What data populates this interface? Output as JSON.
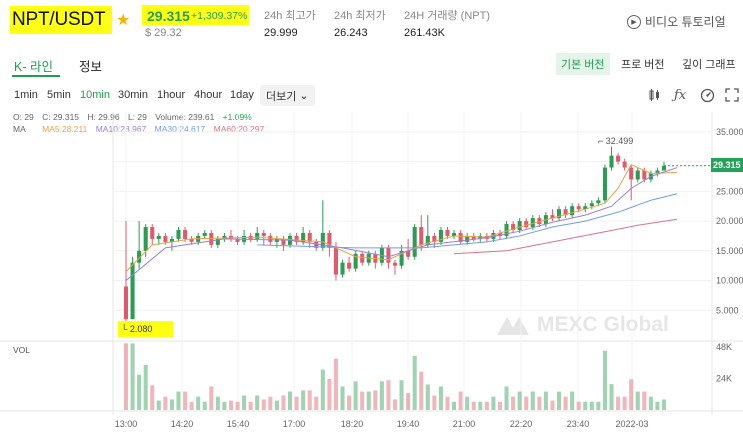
{
  "header": {
    "pair": "NPT/USDT",
    "last_price": "29.315",
    "change_pct": "+1,309.37%",
    "usd_price": "$ 29.32",
    "stats": [
      {
        "label": "24h 최고가",
        "value": "29.999"
      },
      {
        "label": "24h 최저가",
        "value": "26.243"
      },
      {
        "label": "24H 거래량 (NPT)",
        "value": "261.43K"
      }
    ],
    "tutorial_label": "비디오 튜토리얼",
    "colors": {
      "highlight": "#ffff14",
      "up": "#2a9d53",
      "down": "#e05a6b",
      "star": "#f5b400"
    }
  },
  "tabs": {
    "kline": "K- 라인",
    "info": "정보",
    "views": [
      "기본 버전",
      "프로 버전",
      "깊이 그래프"
    ]
  },
  "toolbar": {
    "timeframes": [
      "1min",
      "5min",
      "10min",
      "30min",
      "1hour",
      "4hour",
      "1day"
    ],
    "active_timeframe": "10min",
    "more_label": "더보기",
    "icons": [
      "candle-type-icon",
      "indicator-fx-icon",
      "settings-icon",
      "fullscreen-icon"
    ]
  },
  "indicators": {
    "ohlc": {
      "o": "O: 29",
      "c": "C: 29.315",
      "h": "H: 29.96",
      "l": "L: 29",
      "volume": "Volume: 239.61",
      "change": "+1.09%"
    },
    "ma_label": "MA",
    "ma5": "MA5:28.211",
    "ma10": "MA10:28.967",
    "ma30": "MA30:24.617",
    "ma60": "MA60:20.297",
    "vol_label": "VOL"
  },
  "watermark": "MEXC Global",
  "chart_data": {
    "type": "candlestick",
    "price_axis": {
      "ticks": [
        "35.000",
        "30.000",
        "25.000",
        "20.000",
        "15.000",
        "10.000",
        "5.000"
      ],
      "min": 0,
      "max": 37
    },
    "volume_axis": {
      "ticks": [
        "48K",
        "24K"
      ],
      "max": 52000
    },
    "time_ticks": [
      "13:00",
      "14:20",
      "15:40",
      "17:00",
      "18:20",
      "19:40",
      "21:00",
      "22:20",
      "23:40",
      "2022-03"
    ],
    "current_price": "29.315",
    "high_label": "32.499",
    "low_label": "2.080",
    "candles": [
      [
        9,
        3.5,
        20,
        2.08
      ],
      [
        3.5,
        13,
        14,
        3.5
      ],
      [
        13,
        15,
        20,
        12
      ],
      [
        15,
        19,
        19.5,
        14
      ],
      [
        19,
        17,
        19.5,
        16
      ],
      [
        17,
        17.5,
        18,
        16
      ],
      [
        17.5,
        16.5,
        18,
        16
      ],
      [
        16.5,
        17,
        17.5,
        15
      ],
      [
        17,
        18.5,
        19,
        16.5
      ],
      [
        18.5,
        17,
        19,
        16.5
      ],
      [
        17,
        16.5,
        17.5,
        16
      ],
      [
        16.5,
        17.5,
        18,
        16
      ],
      [
        17.5,
        18,
        18.5,
        17
      ],
      [
        18,
        16,
        18.5,
        15.5
      ],
      [
        16,
        17,
        17.5,
        15.5
      ],
      [
        17,
        17.5,
        18,
        16.5
      ],
      [
        17.5,
        17,
        18.5,
        16.5
      ],
      [
        17,
        16.5,
        17.5,
        16
      ],
      [
        16.5,
        17.5,
        18.5,
        16
      ],
      [
        17.5,
        17,
        18,
        16.5
      ],
      [
        17,
        18,
        19,
        16.5
      ],
      [
        18,
        17.5,
        18.5,
        16
      ],
      [
        17.5,
        16.5,
        18,
        16
      ],
      [
        16.5,
        17,
        17.5,
        15.5
      ],
      [
        17,
        16,
        17.5,
        15
      ],
      [
        16,
        17.5,
        18,
        15.5
      ],
      [
        17.5,
        16.5,
        18,
        16
      ],
      [
        16.5,
        18,
        19,
        16
      ],
      [
        18,
        16.5,
        18.5,
        15.5
      ],
      [
        16.5,
        15.5,
        17,
        15
      ],
      [
        15.5,
        18,
        23.5,
        15
      ],
      [
        18,
        15.5,
        18.5,
        14
      ],
      [
        15.5,
        11,
        16.5,
        10
      ],
      [
        11,
        13,
        13.5,
        10.5
      ],
      [
        13,
        12,
        14,
        11.5
      ],
      [
        12,
        14.5,
        15,
        11.5
      ],
      [
        14.5,
        13,
        15,
        12.5
      ],
      [
        13,
        14.5,
        15,
        12.5
      ],
      [
        14.5,
        13,
        15,
        12
      ],
      [
        13,
        15.5,
        16,
        12.5
      ],
      [
        15.5,
        13,
        16,
        12
      ],
      [
        13,
        12.5,
        13.5,
        11
      ],
      [
        12.5,
        15,
        16,
        12
      ],
      [
        15,
        14,
        17,
        13.5
      ],
      [
        14,
        19,
        19.5,
        13.5
      ],
      [
        19,
        16,
        21,
        15
      ],
      [
        16,
        17.5,
        21,
        15.5
      ],
      [
        17.5,
        16.5,
        18,
        15.5
      ],
      [
        16.5,
        18.5,
        19,
        16
      ],
      [
        18.5,
        17.5,
        19,
        17
      ],
      [
        17.5,
        18,
        18.5,
        17
      ],
      [
        18,
        16.5,
        18.5,
        16
      ],
      [
        16.5,
        17.5,
        18,
        16
      ],
      [
        17.5,
        17,
        18,
        16.5
      ],
      [
        17,
        17.5,
        18,
        16.5
      ],
      [
        17.5,
        17,
        18,
        16.5
      ],
      [
        17,
        18,
        18.5,
        16.5
      ],
      [
        18,
        17.5,
        18.5,
        17
      ],
      [
        17.5,
        19.5,
        20,
        17
      ],
      [
        19.5,
        18.5,
        20,
        18
      ],
      [
        18.5,
        20,
        20.5,
        18
      ],
      [
        20,
        19,
        20.5,
        18.5
      ],
      [
        19,
        20.5,
        21,
        18.5
      ],
      [
        20.5,
        19.5,
        21,
        19
      ],
      [
        19.5,
        21,
        21.5,
        19
      ],
      [
        21,
        20.5,
        22,
        20
      ],
      [
        20.5,
        22,
        22.5,
        20
      ],
      [
        22,
        21,
        22.5,
        20.5
      ],
      [
        21,
        22.5,
        23,
        20.5
      ],
      [
        22.5,
        22,
        23,
        21.5
      ],
      [
        22,
        22.5,
        23,
        21.5
      ],
      [
        22.5,
        23,
        23.5,
        22
      ],
      [
        23,
        23.5,
        24,
        22.5
      ],
      [
        23.5,
        29,
        29.5,
        23
      ],
      [
        29,
        31,
        32.5,
        28.5
      ],
      [
        31,
        30,
        31.5,
        29.5
      ],
      [
        30,
        29,
        30.5,
        28.5
      ],
      [
        29,
        27,
        29.5,
        23.5
      ],
      [
        27,
        28.5,
        29,
        26.5
      ],
      [
        28.5,
        27,
        29,
        26.5
      ],
      [
        27,
        28,
        28.5,
        26.5
      ],
      [
        28,
        28.5,
        29,
        27.5
      ],
      [
        28.5,
        29.3,
        29.96,
        28.5
      ]
    ],
    "ma5": [
      [
        0,
        11.5
      ],
      [
        4,
        16
      ],
      [
        10,
        17
      ],
      [
        20,
        17.3
      ],
      [
        30,
        16.5
      ],
      [
        35,
        14
      ],
      [
        40,
        13.5
      ],
      [
        45,
        16
      ],
      [
        50,
        17.5
      ],
      [
        55,
        17.3
      ],
      [
        60,
        19
      ],
      [
        65,
        20.5
      ],
      [
        70,
        22
      ],
      [
        73,
        23
      ],
      [
        75,
        25.5
      ],
      [
        77,
        29.5
      ],
      [
        80,
        28
      ],
      [
        84,
        28.2
      ]
    ],
    "ma10": [
      [
        0,
        10
      ],
      [
        6,
        15.5
      ],
      [
        15,
        17
      ],
      [
        25,
        16.8
      ],
      [
        33,
        15.5
      ],
      [
        40,
        14
      ],
      [
        46,
        16
      ],
      [
        55,
        17.2
      ],
      [
        60,
        18.3
      ],
      [
        65,
        19.8
      ],
      [
        70,
        21
      ],
      [
        74,
        22.5
      ],
      [
        77,
        25.5
      ],
      [
        80,
        27.5
      ],
      [
        84,
        29
      ]
    ],
    "ma30": [
      [
        20,
        16
      ],
      [
        35,
        15.5
      ],
      [
        45,
        15.5
      ],
      [
        55,
        16.5
      ],
      [
        60,
        17.5
      ],
      [
        65,
        19
      ],
      [
        70,
        20
      ],
      [
        75,
        21.5
      ],
      [
        80,
        23.5
      ],
      [
        84,
        24.6
      ]
    ],
    "ma60": [
      [
        50,
        14.5
      ],
      [
        58,
        15
      ],
      [
        65,
        16.5
      ],
      [
        72,
        18
      ],
      [
        78,
        19.3
      ],
      [
        84,
        20.3
      ]
    ]
  }
}
